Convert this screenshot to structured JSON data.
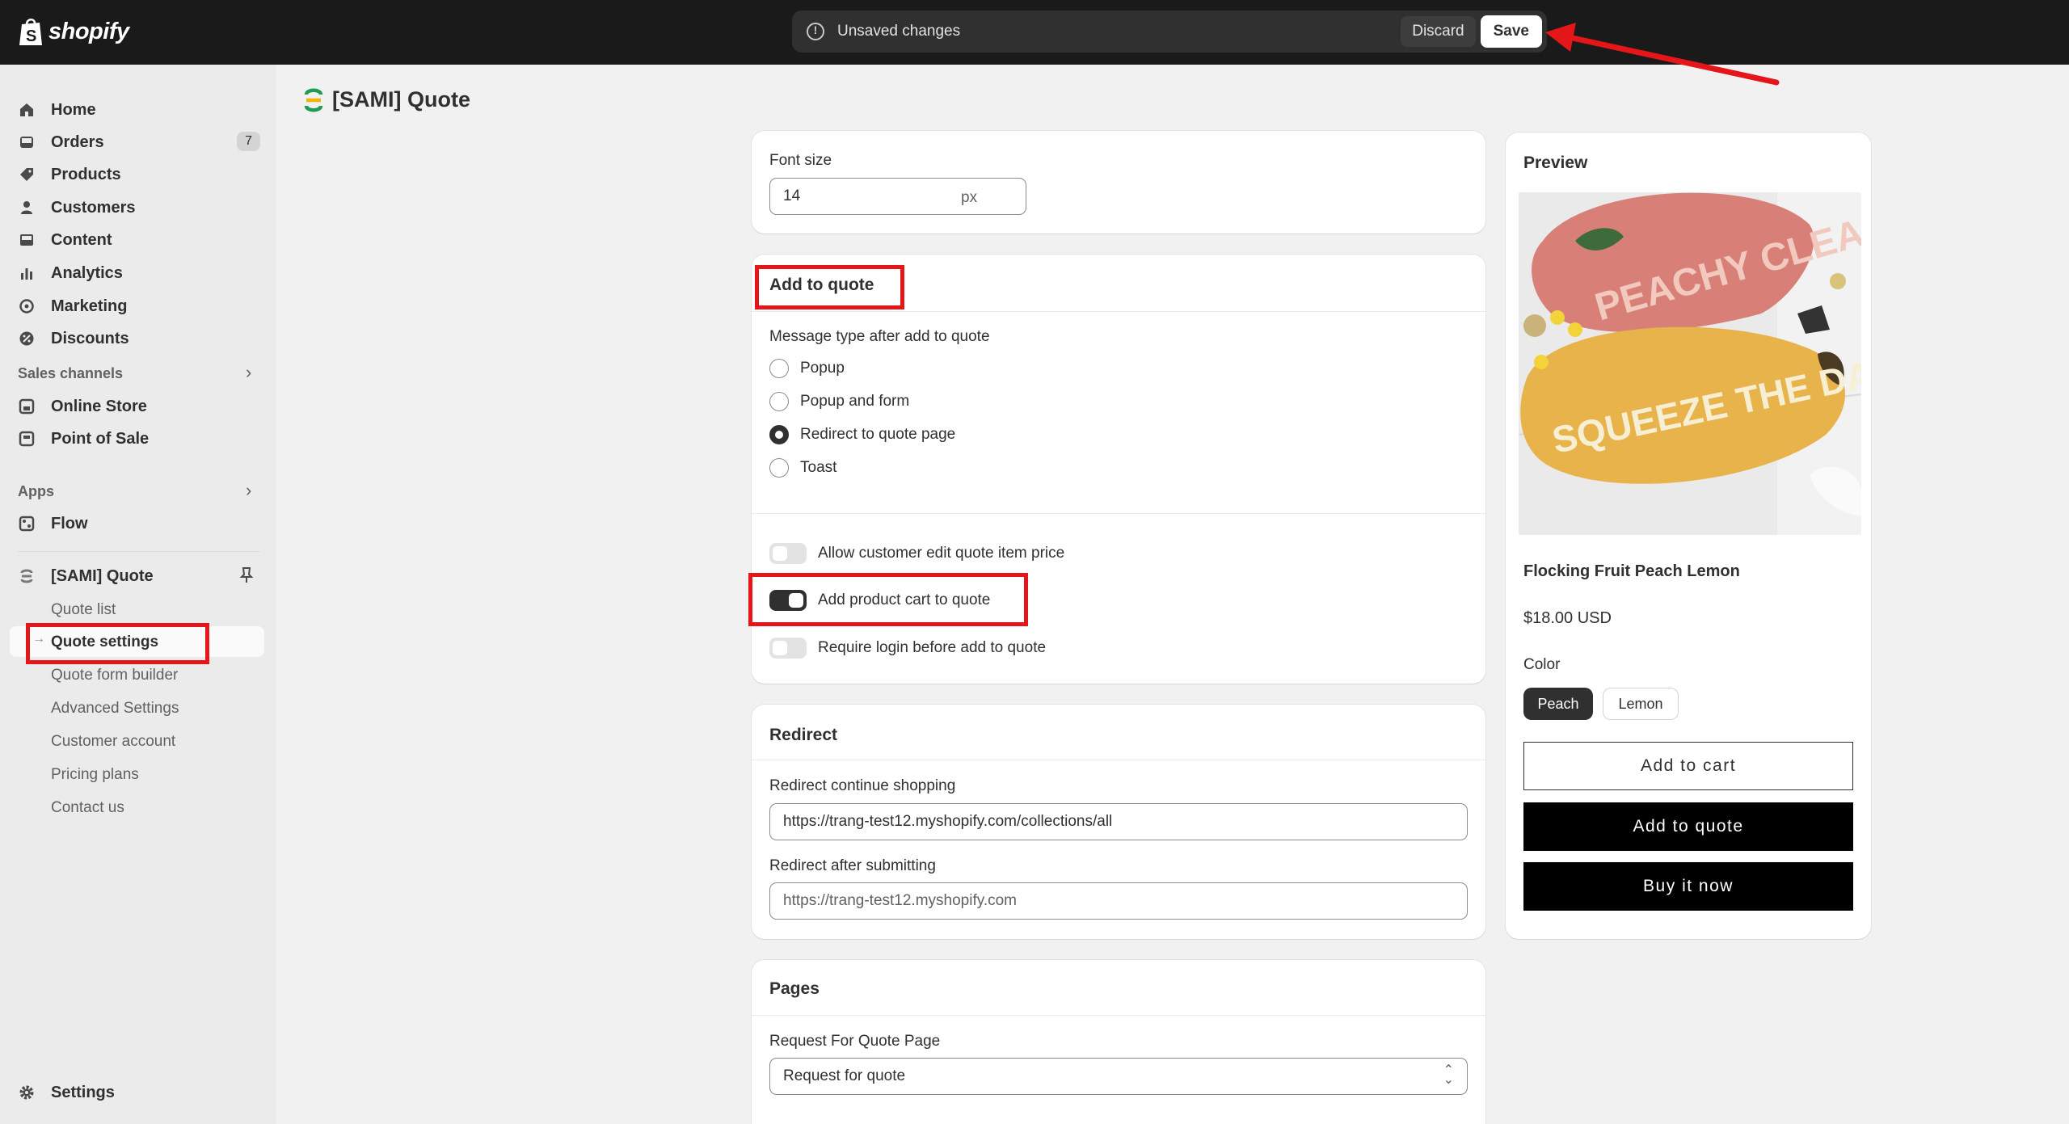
{
  "topbar": {
    "brand": "shopify",
    "unsaved_message": "Unsaved changes",
    "discard_label": "Discard",
    "save_label": "Save"
  },
  "sidebar": {
    "main_items": [
      {
        "label": "Home",
        "icon": "home-icon"
      },
      {
        "label": "Orders",
        "icon": "inbox-icon",
        "badge": "7"
      },
      {
        "label": "Products",
        "icon": "tag-icon"
      },
      {
        "label": "Customers",
        "icon": "person-icon"
      },
      {
        "label": "Content",
        "icon": "image-icon"
      },
      {
        "label": "Analytics",
        "icon": "bar-chart-icon"
      },
      {
        "label": "Marketing",
        "icon": "target-icon"
      },
      {
        "label": "Discounts",
        "icon": "discount-icon"
      }
    ],
    "sales_channels_label": "Sales channels",
    "sales_channels": [
      {
        "label": "Online Store",
        "icon": "store-icon"
      },
      {
        "label": "Point of Sale",
        "icon": "pos-icon"
      }
    ],
    "apps_label": "Apps",
    "apps": [
      {
        "label": "Flow",
        "icon": "flow-icon"
      }
    ],
    "app_name": "[SAMI] Quote",
    "app_subitems": [
      "Quote list",
      "Quote settings",
      "Quote form builder",
      "Advanced Settings",
      "Customer account",
      "Pricing plans",
      "Contact us"
    ],
    "active_subitem": "Quote settings",
    "settings_label": "Settings"
  },
  "page": {
    "title": "[SAMI] Quote"
  },
  "font_size_card": {
    "label": "Font size",
    "value": "14",
    "suffix": "px"
  },
  "add_to_quote_card": {
    "title": "Add to quote",
    "message_type_label": "Message type after add to quote",
    "options": [
      "Popup",
      "Popup and form",
      "Redirect to quote page",
      "Toast"
    ],
    "selected_option": "Redirect to quote page",
    "toggles": [
      {
        "label": "Allow customer edit quote item price",
        "on": false
      },
      {
        "label": "Add product cart to quote",
        "on": true
      },
      {
        "label": "Require login before add to quote",
        "on": false
      }
    ]
  },
  "redirect_card": {
    "title": "Redirect",
    "continue_label": "Redirect continue shopping",
    "continue_value": "https://trang-test12.myshopify.com/collections/all",
    "after_label": "Redirect after submitting",
    "after_placeholder": "https://trang-test12.myshopify.com"
  },
  "pages_card": {
    "title": "Pages",
    "request_label": "Request For Quote Page",
    "request_value": "Request for quote"
  },
  "preview": {
    "title": "Preview",
    "image_text_top": "PEACHY CLEAN",
    "image_text_bottom": "SQUEEZE THE DAY",
    "product_name": "Flocking Fruit Peach Lemon",
    "price": "$18.00 USD",
    "color_label": "Color",
    "colors": [
      "Peach",
      "Lemon"
    ],
    "selected_color": "Peach",
    "add_to_cart_label": "Add to cart",
    "add_to_quote_label": "Add to quote",
    "buy_now_label": "Buy it now"
  },
  "colors": {
    "topbar": "#1a1a1a",
    "annotation_red": "#e5161a",
    "button_dark": "#000000"
  }
}
